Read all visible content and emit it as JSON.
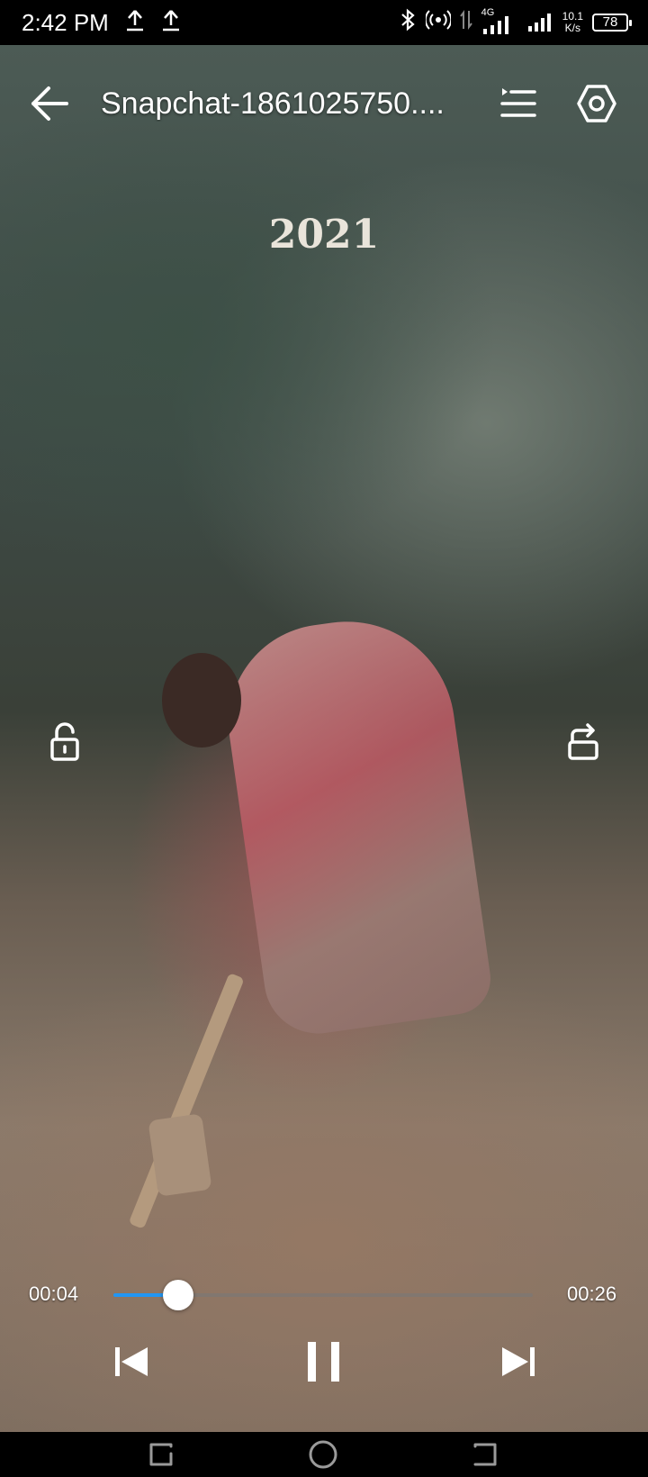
{
  "status_bar": {
    "time": "2:42 PM",
    "network_type": "4G",
    "speed_value": "10.1",
    "speed_unit": "K/s",
    "battery": "78"
  },
  "video": {
    "caption": "2021"
  },
  "top_bar": {
    "title": "Snapchat-1861025750...."
  },
  "player": {
    "current_time": "00:04",
    "total_time": "00:26",
    "progress": 0.155,
    "accent_color": "#2196f3"
  },
  "icons": {
    "back": "arrow-left",
    "playlist": "playlist",
    "settings": "hexagon-settings",
    "lock": "unlock",
    "rotate": "screen-rotate",
    "prev": "skip-previous",
    "pause": "pause",
    "next": "skip-next"
  }
}
